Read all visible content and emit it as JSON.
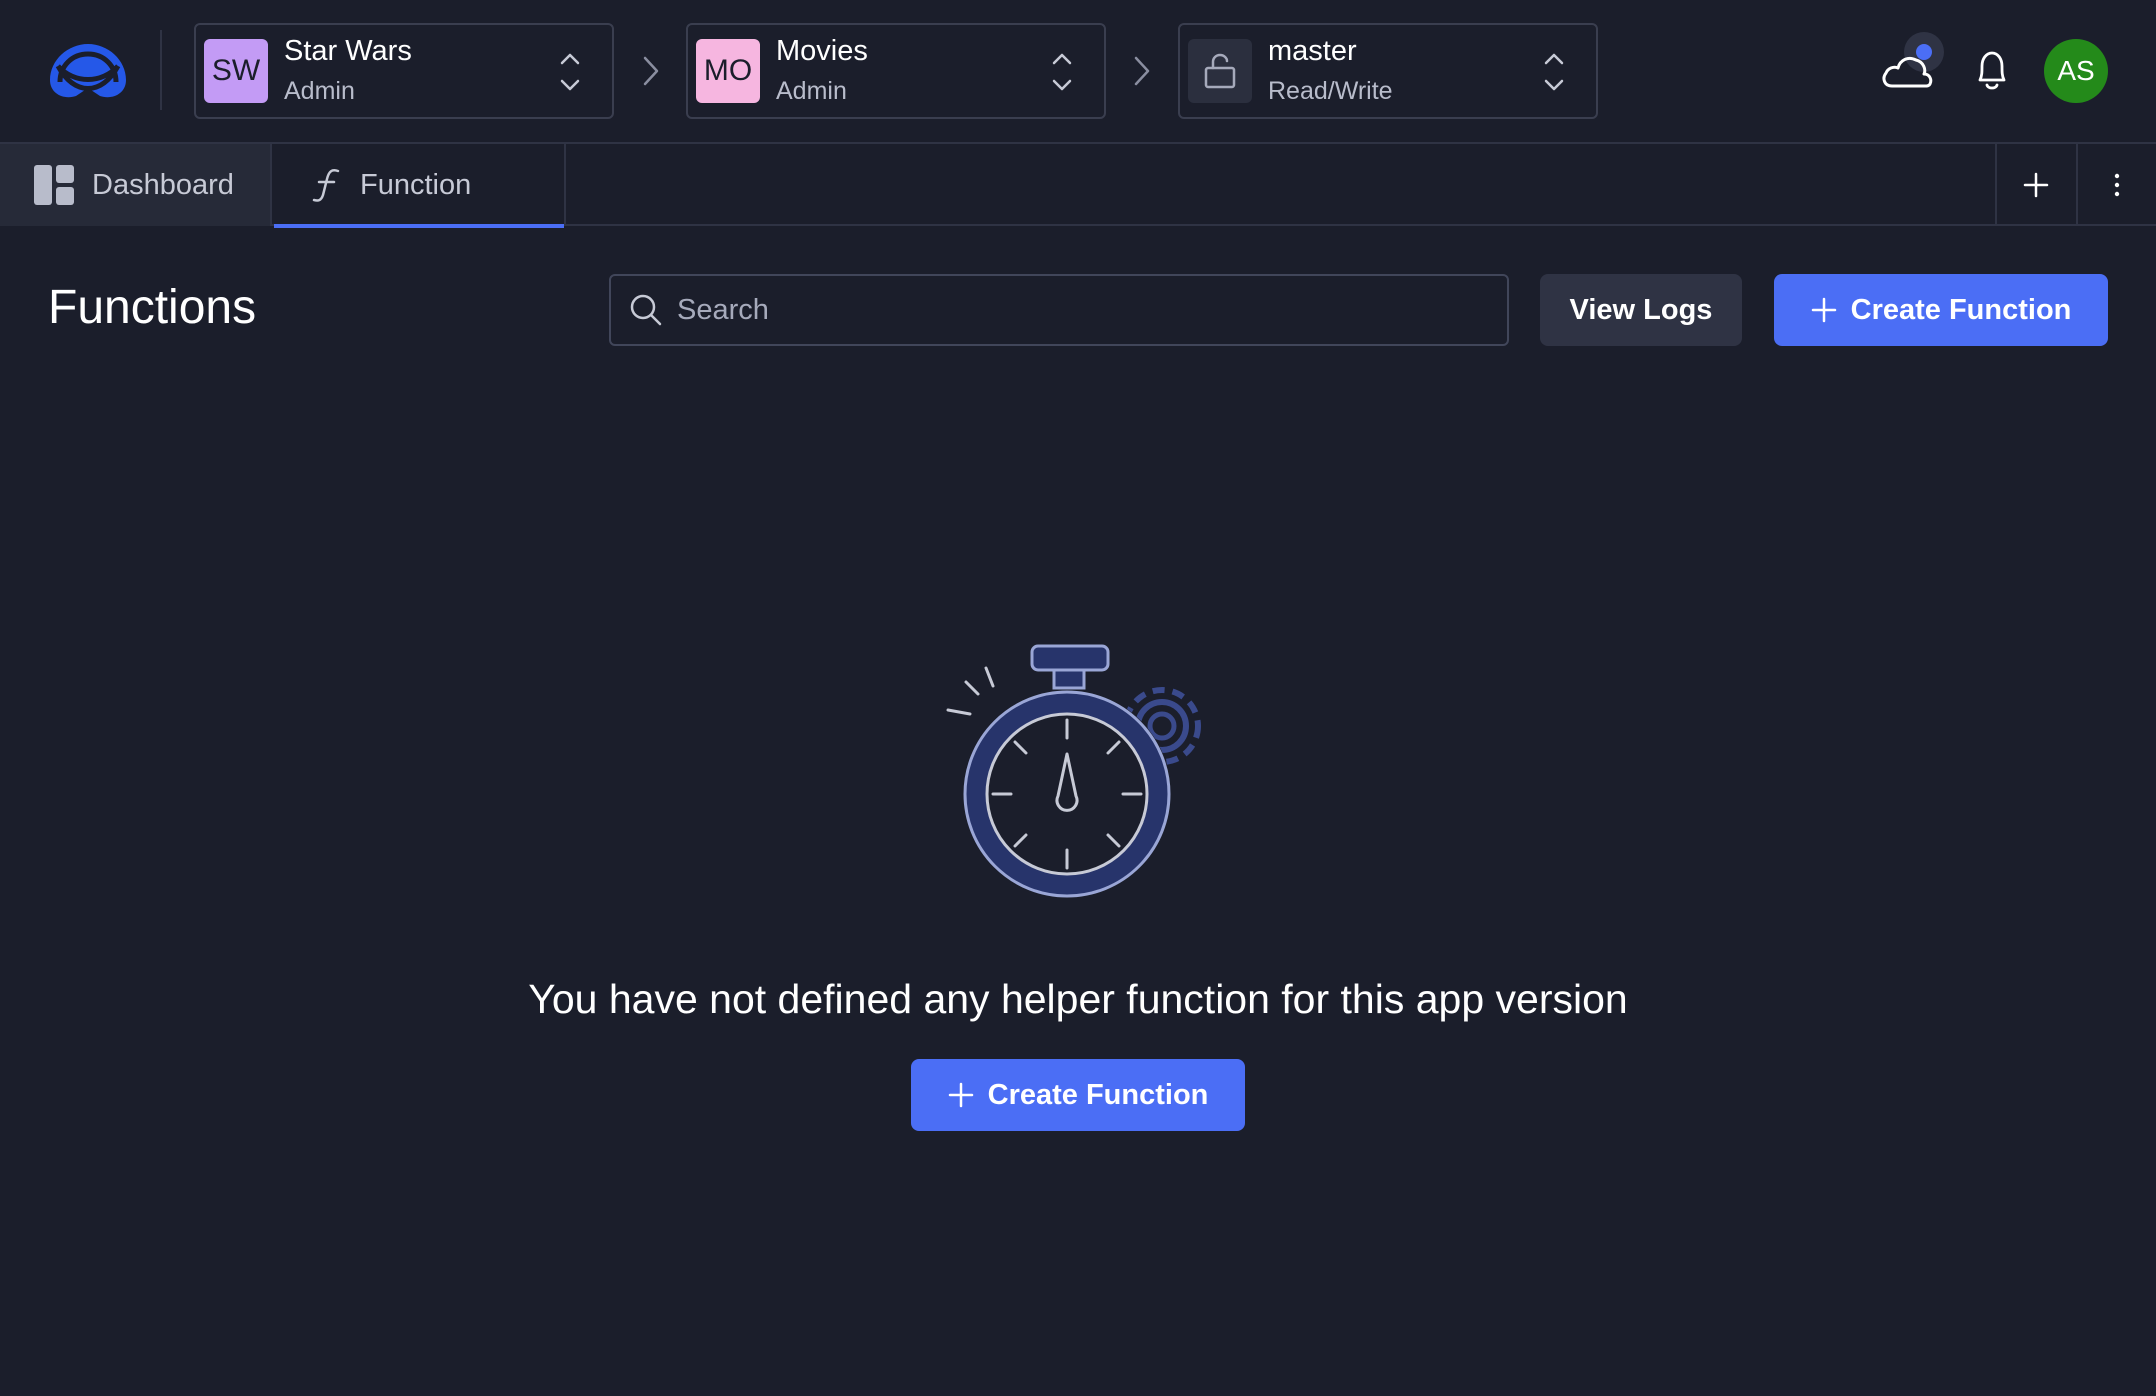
{
  "topbar": {
    "org": {
      "initials": "SW",
      "name": "Star Wars",
      "role": "Admin",
      "color": "#c39bf5"
    },
    "app": {
      "initials": "MO",
      "name": "Movies",
      "role": "Admin",
      "color": "#f6b6e0"
    },
    "branch": {
      "name": "master",
      "access": "Read/Write"
    },
    "user_initials": "AS"
  },
  "tabs": [
    {
      "label": "Dashboard",
      "icon": "dashboard-icon"
    },
    {
      "label": "Function",
      "icon": "function-icon",
      "active": true
    }
  ],
  "header": {
    "title": "Functions",
    "search_placeholder": "Search",
    "view_logs_label": "View Logs",
    "create_label": "Create Function"
  },
  "empty_state": {
    "message": "You have not defined any helper function for this app version",
    "create_label": "Create Function",
    "illustration": "stopwatch-gear-icon"
  },
  "colors": {
    "background": "#1b1e2b",
    "accent": "#4b6ef5",
    "user_avatar": "#248a1a"
  }
}
